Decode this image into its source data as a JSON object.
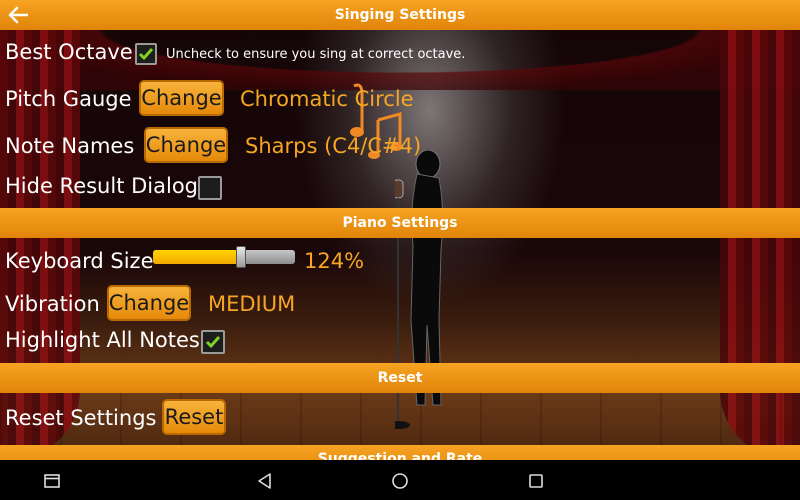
{
  "header": {
    "title": "Singing Settings"
  },
  "singing": {
    "best_octave": {
      "label": "Best Octave",
      "checked": true,
      "hint": "Uncheck to ensure you sing at correct octave."
    },
    "pitch_gauge": {
      "label": "Pitch Gauge",
      "button": "Change",
      "value": "Chromatic Circle"
    },
    "note_names": {
      "label": "Note Names",
      "button": "Change",
      "value": "Sharps (C4/C#4)"
    },
    "hide_result": {
      "label": "Hide Result Dialog",
      "checked": false
    }
  },
  "piano": {
    "header": "Piano Settings",
    "keyboard_size": {
      "label": "Keyboard Size",
      "value": "124%",
      "slider_fraction": 0.62
    },
    "vibration": {
      "label": "Vibration",
      "button": "Change",
      "value": "MEDIUM"
    },
    "highlight_all": {
      "label": "Highlight All Notes",
      "checked": true
    }
  },
  "reset": {
    "header": "Reset",
    "label": "Reset Settings",
    "button": "Reset"
  },
  "next_section": {
    "header": "Suggestion and Rate"
  },
  "colors": {
    "accent": "#f5a623",
    "header": "#e18509",
    "check": "#7ed321"
  },
  "navbar": {
    "icons": [
      "recents-window-icon",
      "back-triangle-icon",
      "home-circle-icon",
      "overview-square-icon"
    ]
  }
}
